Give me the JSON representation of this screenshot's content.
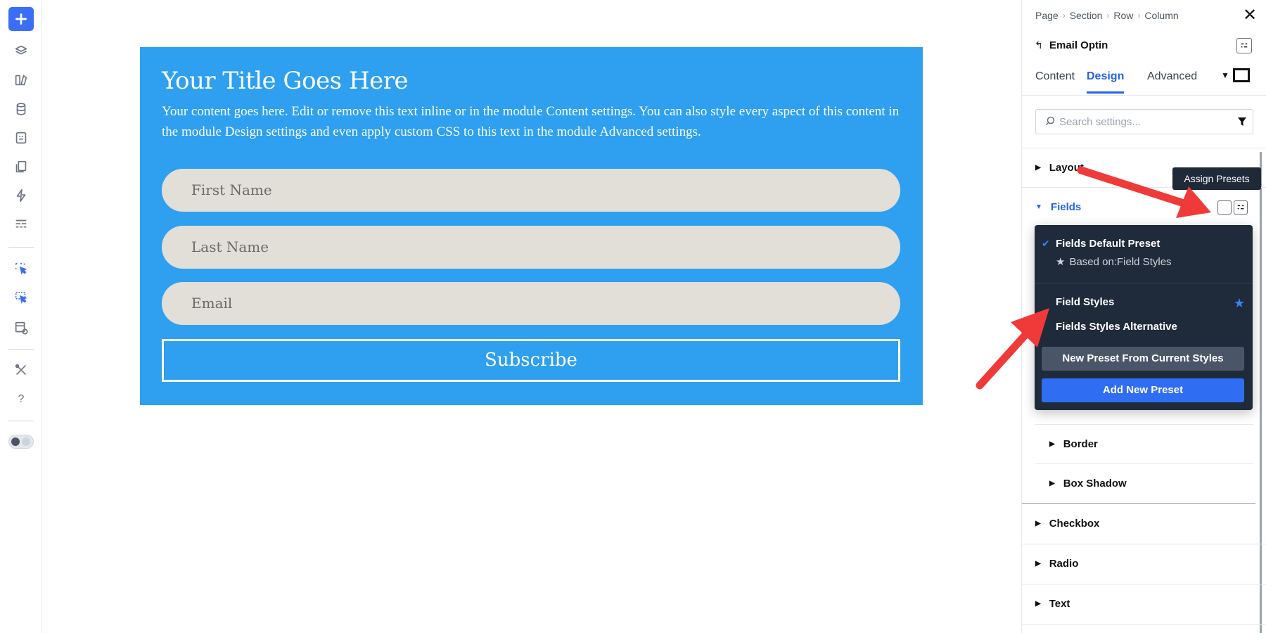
{
  "toolbar": {
    "items": [
      "add-icon",
      "layers-icon",
      "design-library-icon",
      "database-icon",
      "template-icon",
      "pages-icon",
      "lightning-icon",
      "sections-icon",
      "cursor-select-icon",
      "multi-select-icon",
      "preview-icon",
      "tools-icon",
      "help-icon",
      "theme-toggle-icon"
    ],
    "help_label": "?"
  },
  "module": {
    "title": "Your Title Goes Here",
    "body": "Your content goes here. Edit or remove this text inline or in the module Content settings. You can also style every aspect of this content in the module Design settings and even apply custom CSS to this text in the module Advanced settings.",
    "fields": [
      {
        "placeholder": "First Name"
      },
      {
        "placeholder": "Last Name"
      },
      {
        "placeholder": "Email"
      }
    ],
    "button_label": "Subscribe",
    "colors": {
      "background": "#2ea0ef",
      "field": "#e2ded8"
    }
  },
  "panel": {
    "breadcrumb": [
      "Page",
      "Section",
      "Row",
      "Column"
    ],
    "breadcrumb_sep": "›",
    "close_label": "✕",
    "back_label": "↰",
    "module_name": "Email Optin",
    "tabs": [
      {
        "label": "Content"
      },
      {
        "label": "Design"
      },
      {
        "label": "Advanced"
      }
    ],
    "active_tab": "Design",
    "search_placeholder": "Search settings...",
    "groups": {
      "layout": "Layout",
      "fields": "Fields",
      "border": "Border",
      "box_shadow": "Box Shadow",
      "checkbox": "Checkbox",
      "radio": "Radio",
      "text": "Text"
    },
    "tooltip": "Assign Presets"
  },
  "dropdown": {
    "default_preset": "Fields Default Preset",
    "based_on": "Based on:Field Styles",
    "presets": [
      "Field Styles",
      "Fields Styles Alternative"
    ],
    "new_from_current": "New Preset From Current Styles",
    "add_new": "Add New Preset",
    "accent": "#2f6df3"
  },
  "annotation": {
    "arrow_color": "#f03a3a"
  }
}
